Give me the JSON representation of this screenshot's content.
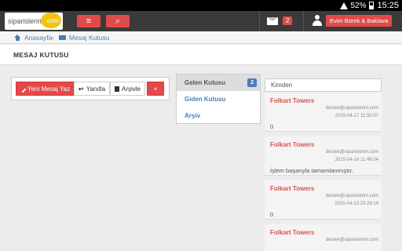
{
  "status_bar": {
    "battery": "52%",
    "time": "15:25"
  },
  "navbar": {
    "logo_text": "siparislerim",
    "logo_suffix": "com",
    "menu_icon": "menu-icon",
    "search_icon": "search-icon",
    "message_count": "2",
    "user_name": "Evim Börek & Baklava"
  },
  "breadcrumb": {
    "home": "Anasayfa",
    "current": "Mesaj Kutusu"
  },
  "page": {
    "title": "MESAJ KUTUSU"
  },
  "toolbar": {
    "new_message": "Yeni Mesaj Yaz",
    "reply": "Yanıtla",
    "archive": "Arşivle",
    "delete": "×"
  },
  "folders": [
    {
      "label": "Gelen Kutusu",
      "badge": "2"
    },
    {
      "label": "Giden Kutusu"
    },
    {
      "label": "Arşiv"
    }
  ],
  "messages": {
    "header": "Kimden",
    "items": [
      {
        "sender": "Folkart Towers",
        "email": "destek@siparislerim.com",
        "date": "2015-04-17 11:50:07",
        "body": "0"
      },
      {
        "sender": "Folkart Towers",
        "email": "destek@siparislerim.com",
        "date": "2015-04-16 11:48:04",
        "body": "İşlem başarıyla tamamlanmıştır."
      },
      {
        "sender": "Folkart Towers",
        "email": "destek@siparislerim.com",
        "date": "2015-04-13 23:28:14",
        "body": "0"
      },
      {
        "sender": "Folkart Towers",
        "email": "destek@siparislerim.com",
        "date": "",
        "body": ""
      }
    ]
  }
}
